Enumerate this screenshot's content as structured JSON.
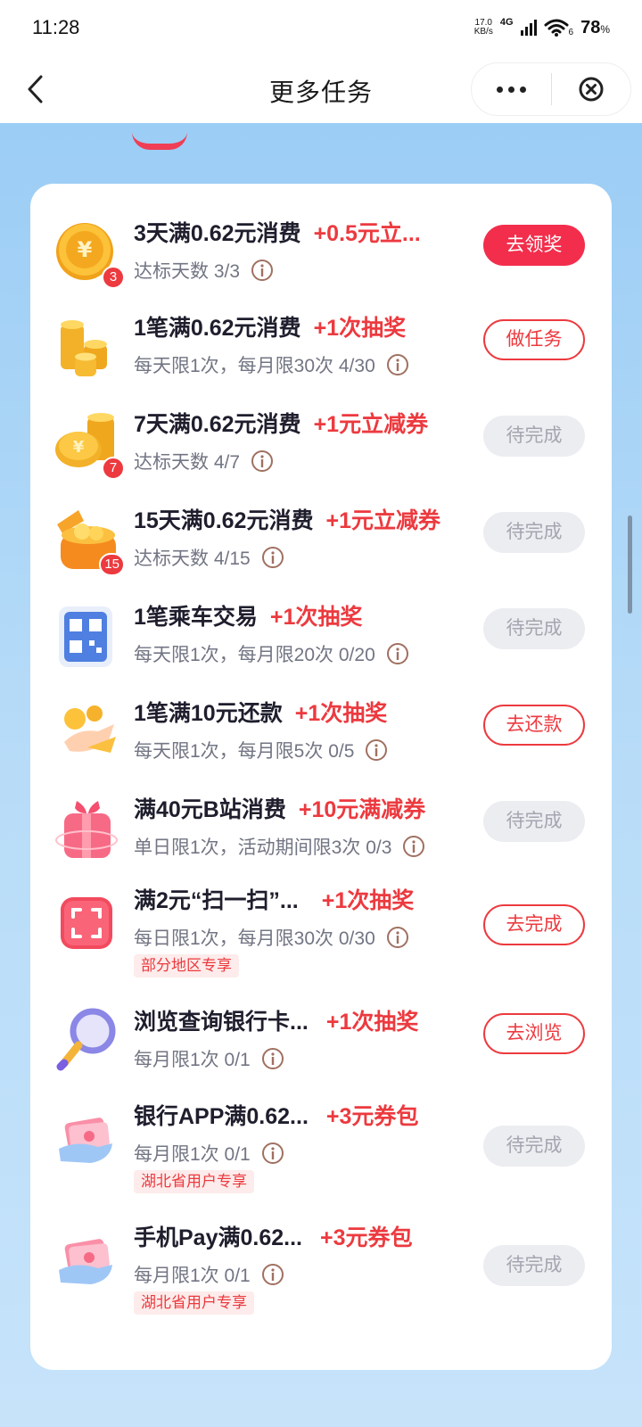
{
  "status_bar": {
    "time": "11:28",
    "net_speed_value": "17.0",
    "net_speed_unit": "KB/s",
    "network": "4G",
    "wifi_sub": "6",
    "battery": "78",
    "battery_unit": "%"
  },
  "nav": {
    "title": "更多任务",
    "back_icon": "chevron-left-icon",
    "more_icon": "more-dots-icon",
    "close_icon": "close-circle-icon"
  },
  "colors": {
    "accent": "#ec3a3f",
    "button_solid": "#f22e4c",
    "disabled_bg": "#ecedf1",
    "background_top": "#9ccdf5"
  },
  "tasks": [
    {
      "title": "3天满0.62元消费",
      "reward": "+0.5元立...",
      "sub": "达标天数  3/3",
      "badge": "3",
      "tag": "",
      "button": "去领奖",
      "button_state": "solid",
      "icon": "gold-coin-icon"
    },
    {
      "title": "1笔满0.62元消费",
      "reward": "+1次抽奖",
      "sub": "每天限1次，每月限30次  4/30",
      "badge": "",
      "tag": "",
      "button": "做任务",
      "button_state": "outline",
      "icon": "coin-stack-icon"
    },
    {
      "title": "7天满0.62元消费",
      "reward": "+1元立减券",
      "sub": "达标天数  4/7",
      "badge": "7",
      "tag": "",
      "button": "待完成",
      "button_state": "disabled",
      "icon": "coin-pile-icon"
    },
    {
      "title": "15天满0.62元消费",
      "reward": "+1元立减券",
      "sub": "达标天数  4/15",
      "badge": "15",
      "tag": "",
      "button": "待完成",
      "button_state": "disabled",
      "icon": "treasure-box-icon"
    },
    {
      "title": "1笔乘车交易",
      "reward": "+1次抽奖",
      "sub": "每天限1次，每月限20次  0/20",
      "badge": "",
      "tag": "",
      "button": "待完成",
      "button_state": "disabled",
      "icon": "qr-code-icon"
    },
    {
      "title": "1笔满10元还款",
      "reward": "+1次抽奖",
      "sub": "每天限1次，每月限5次  0/5",
      "badge": "",
      "tag": "",
      "button": "去还款",
      "button_state": "outline",
      "icon": "hand-coin-icon"
    },
    {
      "title": "满40元B站消费",
      "reward": "+10元满减券",
      "sub": "单日限1次，活动期间限3次  0/3",
      "badge": "",
      "tag": "",
      "button": "待完成",
      "button_state": "disabled",
      "icon": "gift-box-icon"
    },
    {
      "title": "满2元“扫一扫”...",
      "reward": "+1次抽奖",
      "sub": "每日限1次，每月限30次  0/30",
      "badge": "",
      "tag": "部分地区专享",
      "button": "去完成",
      "button_state": "outline",
      "icon": "scan-icon"
    },
    {
      "title": "浏览查询银行卡...",
      "reward": "+1次抽奖",
      "sub": "每月限1次  0/1",
      "badge": "",
      "tag": "",
      "button": "去浏览",
      "button_state": "outline",
      "icon": "magnifier-icon"
    },
    {
      "title": "银行APP满0.62...",
      "reward": "+3元券包",
      "sub": "每月限1次  0/1",
      "badge": "",
      "tag": "湖北省用户专享",
      "button": "待完成",
      "button_state": "disabled",
      "icon": "cash-hand-icon"
    },
    {
      "title": "手机Pay满0.62...",
      "reward": "+3元券包",
      "sub": "每月限1次  0/1",
      "badge": "",
      "tag": "湖北省用户专享",
      "button": "待完成",
      "button_state": "disabled",
      "icon": "cash-hand-icon"
    }
  ]
}
